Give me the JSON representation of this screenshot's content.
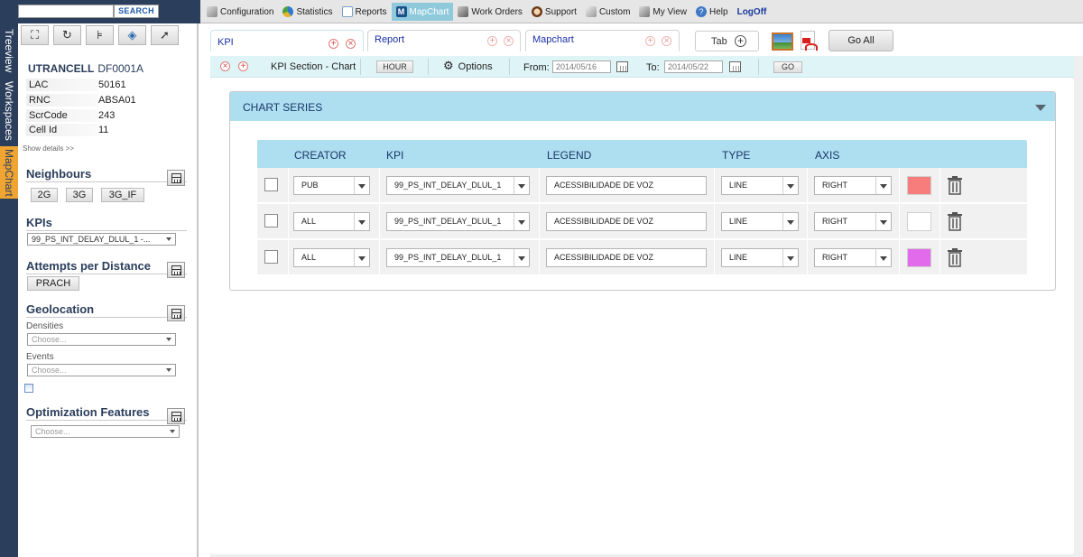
{
  "topbar": {
    "search_placeholder": "",
    "search_button": "SEARCH",
    "menu": [
      {
        "label": "Configuration",
        "icon": "wrench-icon"
      },
      {
        "label": "Statistics",
        "icon": "pie-icon"
      },
      {
        "label": "Reports",
        "icon": "report-icon"
      },
      {
        "label": "MapChart",
        "icon": "mapchart-icon",
        "active": true
      },
      {
        "label": "Work Orders",
        "icon": "tools-icon"
      },
      {
        "label": "Support",
        "icon": "support-icon"
      },
      {
        "label": "Custom",
        "icon": "custom-icon"
      },
      {
        "label": "My View",
        "icon": "myview-icon"
      },
      {
        "label": "Help",
        "icon": "help-icon"
      },
      {
        "label": "LogOff",
        "icon": ""
      }
    ]
  },
  "vtabs": [
    "Treeview",
    "Workspaces",
    "MapChart"
  ],
  "cell": {
    "type": "UTRANCELL",
    "id": "DF0001A",
    "rows": [
      {
        "key": "LAC",
        "value": "50161"
      },
      {
        "key": "RNC",
        "value": "ABSA01"
      },
      {
        "key": "ScrCode",
        "value": "243"
      },
      {
        "key": "Cell Id",
        "value": "11"
      }
    ],
    "show_details": "Show details >>"
  },
  "neighbours": {
    "title": "Neighbours",
    "chips": [
      "2G",
      "3G",
      "3G_IF"
    ]
  },
  "kpis": {
    "title": "KPIs",
    "selected": "99_PS_INT_DELAY_DLUL_1 -..."
  },
  "attempts": {
    "title": "Attempts per Distance",
    "chip": "PRACH"
  },
  "geolocation": {
    "title": "Geolocation",
    "densities_label": "Densities",
    "densities_placeholder": "Choose...",
    "events_label": "Events",
    "events_placeholder": "Choose..."
  },
  "optimization": {
    "title": "Optimization Features",
    "placeholder": "Choose..."
  },
  "tabs": [
    {
      "label": "KPI",
      "active": true
    },
    {
      "label": "Report",
      "active": false
    },
    {
      "label": "Mapchart",
      "active": false
    }
  ],
  "tab_button": "Tab",
  "goall_button": "Go All",
  "kpibar": {
    "section": "KPI Section - Chart",
    "granularity": "HOUR",
    "options": "Options",
    "from_label": "From:",
    "from_value": "2014/05/16",
    "to_label": "To:",
    "to_value": "2014/05/22",
    "go": "GO"
  },
  "chart_series": {
    "title": "CHART SERIES",
    "columns": [
      "CREATOR",
      "KPI",
      "LEGEND",
      "TYPE",
      "AXIS"
    ],
    "rows": [
      {
        "creator": "PUB",
        "kpi": "99_PS_INT_DELAY_DLUL_1",
        "legend": "ACESSIBILIDADE DE VOZ",
        "type": "LINE",
        "axis": "RIGHT",
        "color": "#f77d7d"
      },
      {
        "creator": "ALL",
        "kpi": "99_PS_INT_DELAY_DLUL_1",
        "legend": "ACESSIBILIDADE DE VOZ",
        "type": "LINE",
        "axis": "RIGHT",
        "color": "#ffffff"
      },
      {
        "creator": "ALL",
        "kpi": "99_PS_INT_DELAY_DLUL_1",
        "legend": "ACESSIBILIDADE DE VOZ",
        "type": "LINE",
        "axis": "RIGHT",
        "color": "#e26bec"
      }
    ]
  },
  "colors": {
    "nav_dark": "#2b3e5c",
    "accent_orange": "#f0a533",
    "header_blue": "#addff0",
    "bar_blue": "#dff4f7"
  }
}
